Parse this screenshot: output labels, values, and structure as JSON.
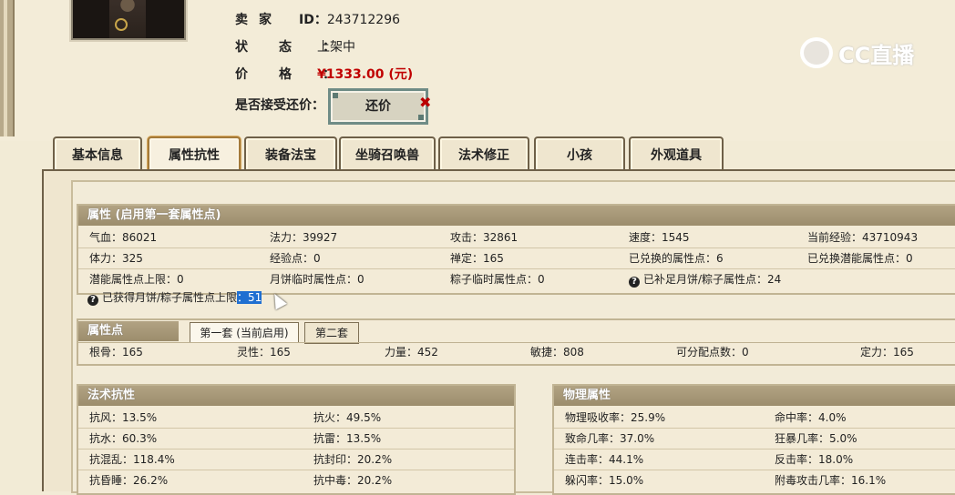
{
  "seller": {
    "id_label": "卖家",
    "id_prefix": "ID：",
    "id_value": "243712296",
    "status_label": "状态：",
    "status_value": "上架中",
    "price_label": "价格：",
    "price_value": "¥1333.00 (元)",
    "counter_label": "是否接受还价：",
    "counter_button": "还价"
  },
  "logo_text": "CC直播",
  "tabs": [
    "基本信息",
    "属性抗性",
    "装备法宝",
    "坐骑召唤兽",
    "法术修正",
    "小孩",
    "外观道具"
  ],
  "attributes": {
    "header": "属性 (启用第一套属性点)",
    "rows": [
      [
        "气血：86021",
        "法力：39927",
        "攻击：32861",
        "速度：1545",
        "当前经验：43710943"
      ],
      [
        "体力：325",
        "经验点：0",
        "禅定：165",
        "已兑换的属性点：6",
        "已兑换潜能属性点：0"
      ],
      [
        "潜能属性点上限：0",
        "月饼临时属性点：0",
        "粽子临时属性点：0",
        "已补足月饼/粽子属性点：24"
      ]
    ],
    "obtained_label": "已获得月饼/粽子属性点上限",
    "obtained_value": "：51"
  },
  "points": {
    "header": "属性点",
    "tab1": "第一套 (当前启用)",
    "tab2": "第二套",
    "values": [
      "根骨：165",
      "灵性：165",
      "力量：452",
      "敏捷：808",
      "可分配点数：0",
      "定力：165"
    ]
  },
  "resistance": {
    "header": "法术抗性",
    "rows": [
      [
        "抗风：13.5%",
        "抗火：49.5%"
      ],
      [
        "抗水：60.3%",
        "抗雷：13.5%"
      ],
      [
        "抗混乱：118.4%",
        "抗封印：20.2%"
      ],
      [
        "抗昏睡：26.2%",
        "抗中毒：20.2%"
      ]
    ]
  },
  "physical": {
    "header": "物理属性",
    "rows": [
      [
        "物理吸收率：25.9%",
        "命中率：4.0%"
      ],
      [
        "致命几率：37.0%",
        "狂暴几率：5.0%"
      ],
      [
        "连击率：44.1%",
        "反击率：18.0%"
      ],
      [
        "躲闪率：15.0%",
        "附毒攻击几率：16.1%"
      ]
    ]
  }
}
